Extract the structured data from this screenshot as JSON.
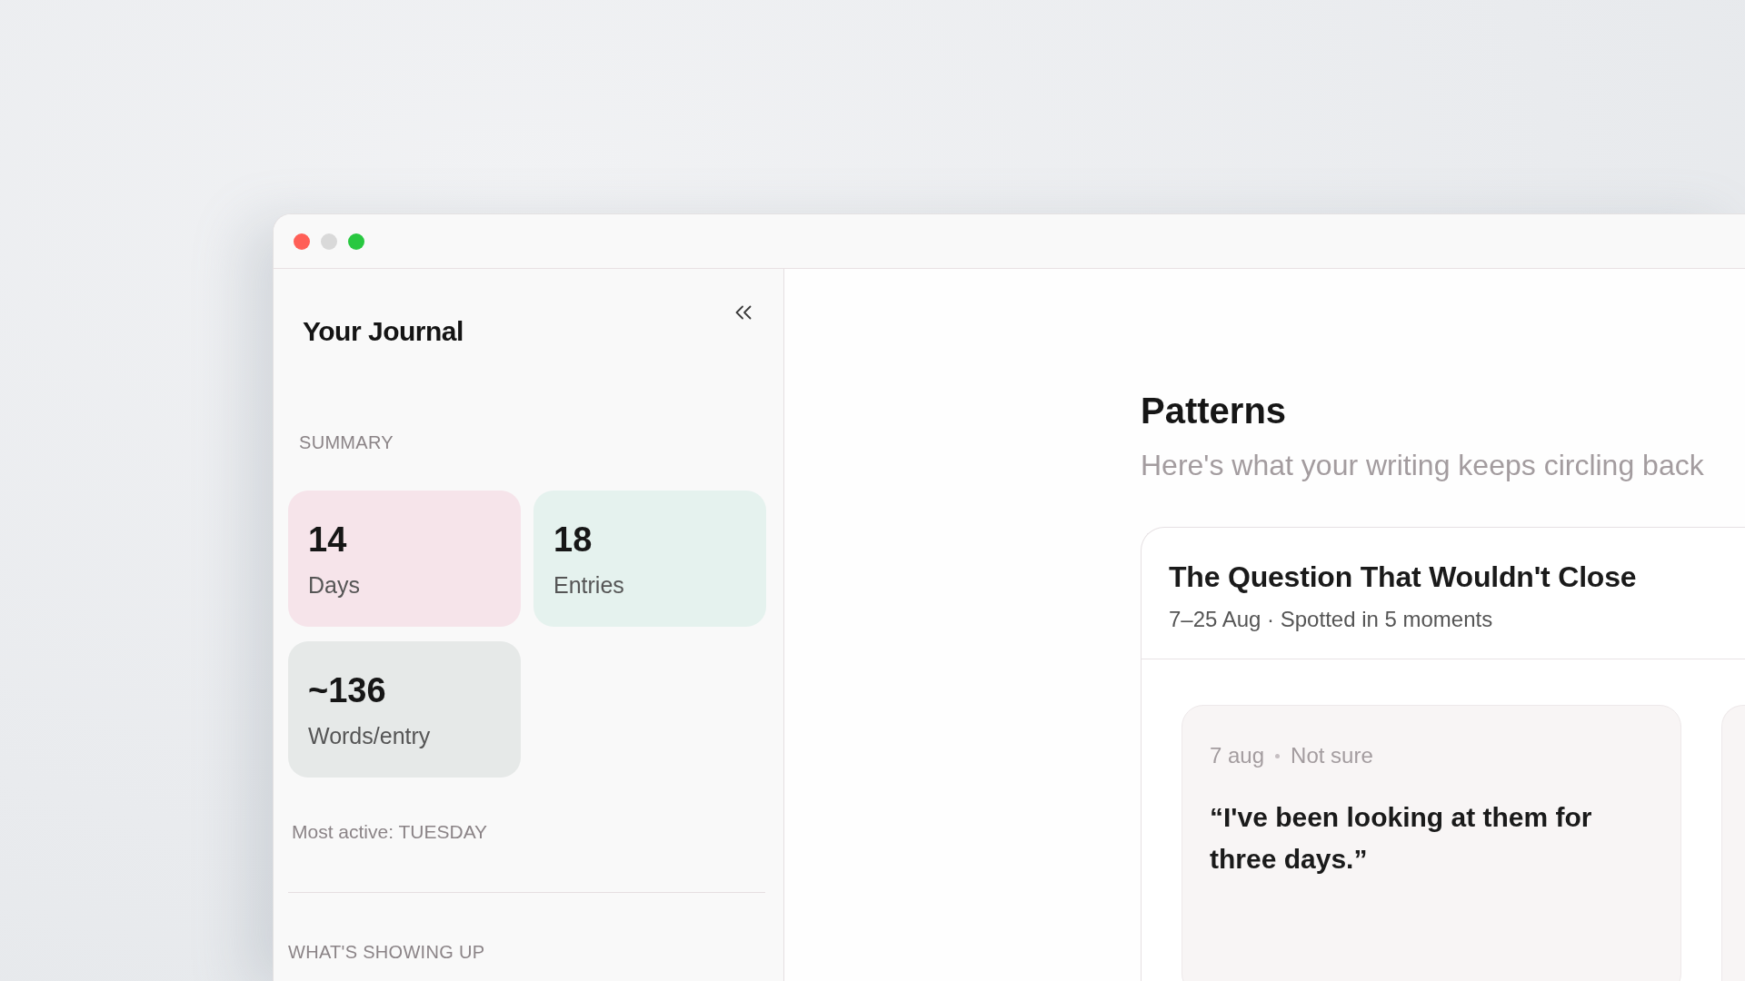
{
  "window": {
    "controls": [
      {
        "kind": "close",
        "disabled": false
      },
      {
        "kind": "minimize",
        "disabled": true
      },
      {
        "kind": "zoom",
        "disabled": false
      }
    ]
  },
  "sidebar": {
    "title": "Your Journal",
    "summary_label": "SUMMARY",
    "stats": [
      {
        "value": "14",
        "label": "Days",
        "color": "#f6e4ea"
      },
      {
        "value": "18",
        "label": "Entries",
        "color": "#e5f2ee"
      },
      {
        "value": "~136",
        "label": "Words/entry",
        "color": "#e6e9e8"
      }
    ],
    "most_active": "Most active: TUESDAY",
    "section_label": "WHAT'S SHOWING UP"
  },
  "main": {
    "title": "Patterns",
    "subtitle": "Here's what your writing keeps circling back",
    "patterns": [
      {
        "title": "The Question That Wouldn't Close",
        "meta": "7–25 Aug · Spotted in 5 moments",
        "moments": [
          {
            "date": "7 aug",
            "mood": "Not sure",
            "quote": "“I've been looking at them for three days.”"
          }
        ]
      }
    ]
  }
}
